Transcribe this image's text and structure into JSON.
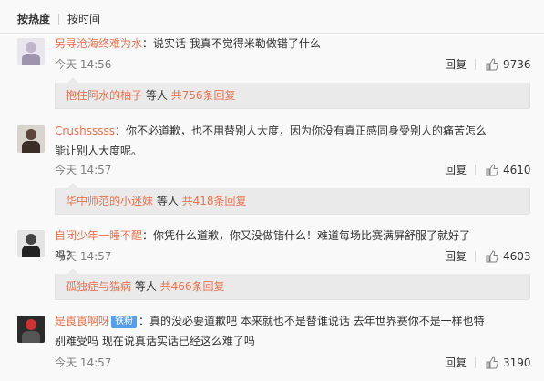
{
  "sort": {
    "active": "按热度",
    "inactive": "按时间"
  },
  "comments": [
    {
      "username": "另寻沧海终难为水",
      "text": "：说实话 我真不觉得米勒做错了什么",
      "time": "今天 14:56",
      "reply": "回复",
      "likes": "9736",
      "sub": {
        "name": "抱住阿水的柚子",
        "middle": " 等人 ",
        "count": "共756条回复"
      }
    },
    {
      "username": "Crushsssss",
      "text": "：你不必道歉，也不用替别人大度，因为你没有真正感同身受别人的痛苦怎么能让别人大度呢。",
      "time": "今天 14:57",
      "reply": "回复",
      "likes": "4610",
      "sub": {
        "name": "华中师范的小迷妹",
        "middle": " 等人 ",
        "count": "共418条回复"
      }
    },
    {
      "username": "自闭少年一睡不醒",
      "text": "：你凭什么道歉，你又没做错什么！难道每场比赛满屏舒服了就好了吗？",
      "time": "今天 14:57",
      "reply": "回复",
      "likes": "4603",
      "sub": {
        "name": "孤独症与猫病",
        "middle": " 等人 ",
        "count": "共466条回复"
      }
    },
    {
      "username": "是崀崀啊呀",
      "badge": "铁粉",
      "text": "：真的没必要道歉吧 本来就也不是替谁说话 去年世界赛你不是一样也特别难受吗 现在说真话实话已经这么难了吗",
      "time": "今天 14:57",
      "reply": "回复",
      "likes": "3190"
    }
  ],
  "icons": {
    "like": "thumbs-up-icon"
  },
  "colors": {
    "username": "#eb7350",
    "meta": "#808080",
    "badge": "#54a0ec"
  }
}
